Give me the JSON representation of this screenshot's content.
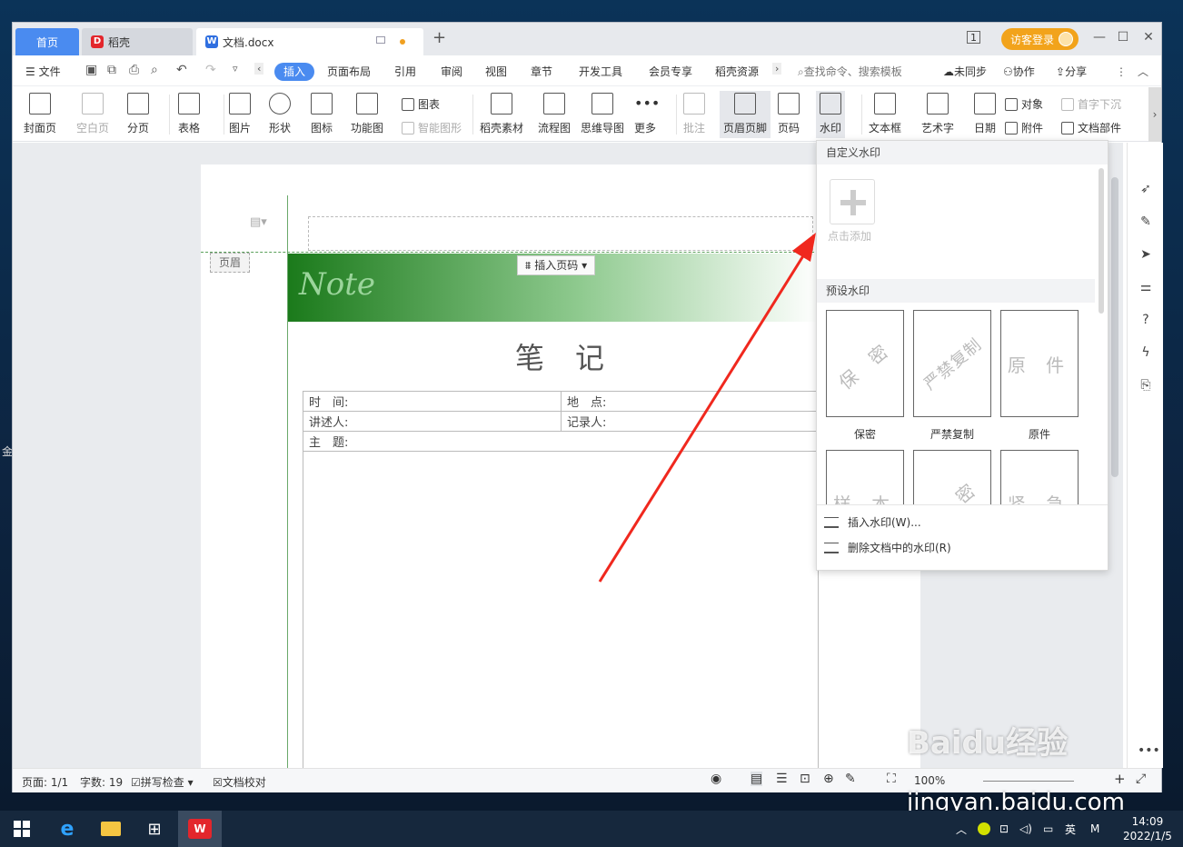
{
  "tabs": {
    "home": "首页",
    "daoke": "稻壳",
    "doc": "文档.docx",
    "new": "+"
  },
  "titlebar": {
    "page_indicator": "1",
    "guest_login": "访客登录",
    "min": "—",
    "max": "☐",
    "close": "✕"
  },
  "menu": {
    "file": "文件",
    "items": [
      "插入",
      "页面布局",
      "引用",
      "审阅",
      "视图",
      "章节",
      "开发工具",
      "会员专享",
      "稻壳资源"
    ],
    "search": "查找命令、搜索模板",
    "sync": "未同步",
    "collab": "协作",
    "share": "分享"
  },
  "ribbon": {
    "cover": "封面页",
    "blank": "空白页",
    "pagebreak": "分页",
    "table": "表格",
    "picture": "图片",
    "shape": "形状",
    "icons": "图标",
    "funcmap": "功能图",
    "chart": "图表",
    "smartart": "智能图形",
    "daoke_assets": "稻壳素材",
    "flowchart": "流程图",
    "mindmap": "思维导图",
    "more": "更多",
    "comment": "批注",
    "header_footer": "页眉页脚",
    "page_num": "页码",
    "watermark": "水印",
    "textbox": "文本框",
    "wordart": "艺术字",
    "date": "日期",
    "object": "对象",
    "attachment": "附件",
    "dropcap": "首字下沉",
    "docpart": "文档部件"
  },
  "document": {
    "header_tag": "页眉",
    "insert_page_num": "插入页码",
    "banner_text": "Note",
    "title": "笔记",
    "rows": [
      [
        "时　间:",
        "地　点:"
      ],
      [
        "讲述人:",
        "记录人:"
      ],
      [
        "主　题:",
        ""
      ]
    ]
  },
  "watermark_pane": {
    "custom_header": "自定义水印",
    "add_label": "点击添加",
    "preset_header": "预设水印",
    "presets": [
      {
        "text": "保 密",
        "label": "保密",
        "rotated": true
      },
      {
        "text": "严禁复制",
        "label": "严禁复制",
        "rotated": true
      },
      {
        "text": "原 件",
        "label": "原件",
        "rotated": false
      },
      {
        "text": "样 本",
        "label": "",
        "rotated": false
      },
      {
        "text": "绝 密",
        "label": "",
        "rotated": true
      },
      {
        "text": "紧 急",
        "label": "",
        "rotated": false
      }
    ],
    "insert": "插入水印(W)...",
    "delete": "删除文档中的水印(R)"
  },
  "status": {
    "page": "页面: 1/1",
    "words": "字数: 19",
    "spell": "拼写检查",
    "proof": "文档校对",
    "zoom": "100%"
  },
  "taskbar": {
    "time": "14:09",
    "date": "2022/1/5",
    "ime": "英",
    "ime2": "M"
  },
  "watermark_overlay": {
    "brand": "Baidu经验",
    "url": "jingyan.baidu.com"
  },
  "colors": {
    "accent": "#4a8bf0",
    "guest": "#f2a31b",
    "arrow": "#f0281e",
    "banner": "#1b7a1b"
  }
}
